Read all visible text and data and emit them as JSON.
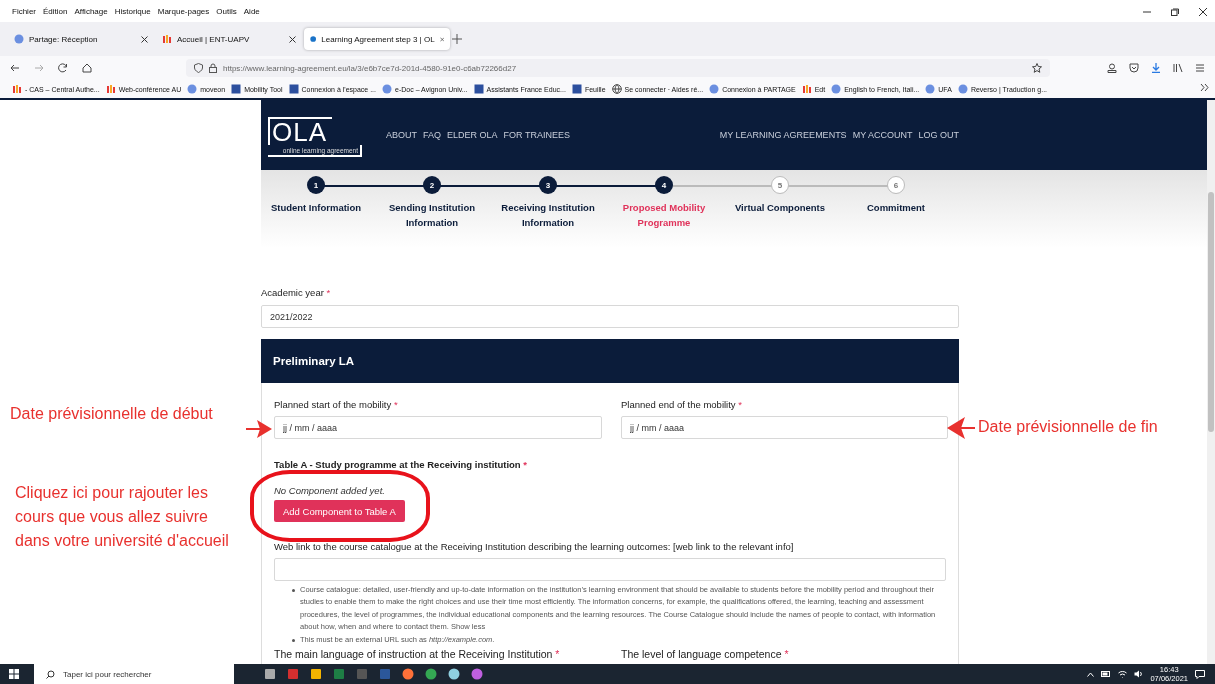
{
  "menu_bar": [
    "Fichier",
    "Édition",
    "Affichage",
    "Historique",
    "Marque-pages",
    "Outils",
    "Aide"
  ],
  "tabs": [
    {
      "title": "Partage: Réception",
      "selected": false
    },
    {
      "title": "Accueil | ENT-UAPV",
      "selected": false
    },
    {
      "title": "Learning Agreement step 3 | OL",
      "selected": true
    }
  ],
  "address_bar": {
    "url": "https://www.learning-agreement.eu/la/3/e6b7ce7d-201d-4580-91e0-c6ab72266d27"
  },
  "bookmarks": [
    "- CAS – Central Authe...",
    "Web-conférence AU",
    "moveon",
    "Mobility Tool",
    "Connexion à l'espace ...",
    "e-Doc – Avignon Univ...",
    "Assistants France Educ...",
    "Feuille",
    "Se connecter · Aides ré...",
    "Connexion à PARTAGE",
    "Edt",
    "English to French, Itali...",
    "UFA",
    "Reverso | Traduction g..."
  ],
  "site_header": {
    "logo": "OLA",
    "logo_tagline": "online learning agreement",
    "nav_left": [
      "ABOUT",
      "FAQ",
      "ELDER OLA",
      "FOR TRAINEES"
    ],
    "nav_right": [
      "MY LEARNING AGREEMENTS",
      "MY ACCOUNT",
      "LOG OUT"
    ]
  },
  "stepper": [
    {
      "number": "1",
      "label": "Student Information",
      "reached": true,
      "selected": false
    },
    {
      "number": "2",
      "label": "Sending Institution Information",
      "reached": true,
      "selected": false
    },
    {
      "number": "3",
      "label": "Receiving Institution Information",
      "reached": true,
      "selected": false
    },
    {
      "number": "4",
      "label": "Proposed Mobility Programme",
      "reached": true,
      "selected": true
    },
    {
      "number": "5",
      "label": "Virtual Components",
      "reached": false,
      "selected": false
    },
    {
      "number": "6",
      "label": "Commitment",
      "reached": false,
      "selected": false
    }
  ],
  "form": {
    "academic_year": {
      "label": "Academic year",
      "mark": "*",
      "value": "2021/2022"
    },
    "panel_title": "Preliminary LA",
    "dates": [
      {
        "label": "Planned start of the mobility",
        "mark": "*",
        "placeholder": "jj / mm / aaaa"
      },
      {
        "label": "Planned end of the mobility",
        "mark": "*",
        "placeholder": "jj / mm / aaaa"
      }
    ],
    "table_a": {
      "title": "Table A - Study programme at the Receiving institution",
      "mark": "*",
      "empty_text": "No Component added yet.",
      "add_button": "Add Component to Table A"
    },
    "web_link": {
      "label": "Web link to the course catalogue at the Receiving Institution describing the learning outcomes: [web link to the relevant info]"
    },
    "help": [
      {
        "text": "Course catalogue: detailed, user-friendly and up-to-date information on the institution’s learning environment that should be available to students before the mobility period and throughout their studies to enable them to make the right choices and use their time most efficiently. The information concerns, for example, the qualifications offered, the learning, teaching and assessment procedures, the level of programmes, the individual educational components and the learning resources. The Course Catalogue should include the names of people to contact, with information about how, when and where to contact them.",
        "link": "Show less"
      },
      {
        "text": "This must be an external URL such as *http://example.com*."
      }
    ],
    "language": [
      {
        "label": "The main language of instruction at the Receiving Institution",
        "mark": "*"
      },
      {
        "label": "The level of language competence",
        "mark": "*"
      }
    ]
  },
  "annotations": [
    {
      "kind": "arrow_right",
      "text": "Date prévisionnelle de début"
    },
    {
      "kind": "arrow_left",
      "text": "Date prévisionnelle de fin"
    },
    {
      "kind": "circle",
      "text": "Cliquez ici pour rajouter les cours que vous allez suivre dans votre université d'accueil"
    }
  ],
  "taskbar": {
    "search_placeholder": "Taper ici pour rechercher",
    "time": "16:43",
    "date": "07/06/2021"
  }
}
